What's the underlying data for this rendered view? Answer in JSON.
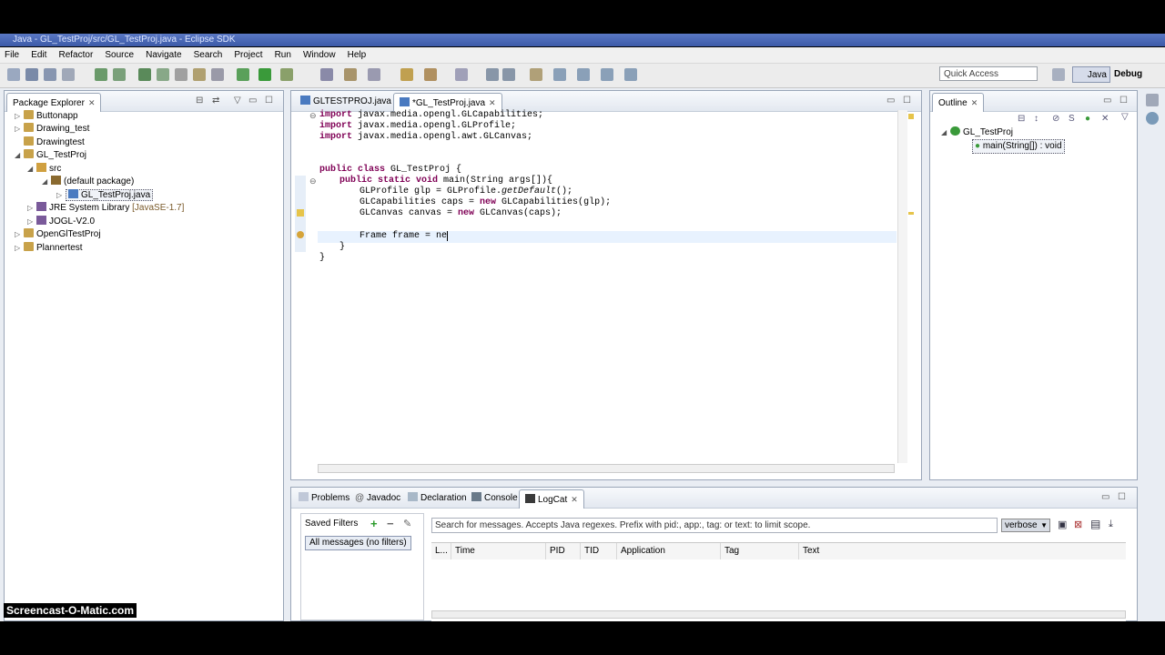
{
  "window": {
    "title": "Java - GL_TestProj/src/GL_TestProj.java - Eclipse SDK"
  },
  "menu": [
    "File",
    "Edit",
    "Refactor",
    "Source",
    "Navigate",
    "Search",
    "Project",
    "Run",
    "Window",
    "Help"
  ],
  "quick_access": {
    "placeholder": "Quick Access"
  },
  "perspectives": {
    "java": "Java",
    "debug": "Debug"
  },
  "package_explorer": {
    "tab": "Package Explorer",
    "items": [
      {
        "label": "Buttonapp"
      },
      {
        "label": "Drawing_test"
      },
      {
        "label": "Drawingtest"
      },
      {
        "label": "GL_TestProj"
      },
      {
        "label": "src"
      },
      {
        "label": "(default package)"
      },
      {
        "label": "GL_TestProj.java"
      },
      {
        "label": "JRE System Library",
        "suffix": "[JavaSE-1.7]"
      },
      {
        "label": "JOGL-V2.0"
      },
      {
        "label": "OpenGlTestProj"
      },
      {
        "label": "Plannertest"
      }
    ]
  },
  "editor": {
    "tabs": [
      {
        "label": "GLTESTPROJ.java"
      },
      {
        "label": "*GL_TestProj.java"
      }
    ],
    "lines": {
      "l1": {
        "kw": "import",
        "rest": " javax.media.opengl.GLCapabilities;"
      },
      "l2": {
        "kw": "import",
        "rest": " javax.media.opengl.GLProfile;"
      },
      "l3": {
        "kw": "import",
        "rest": " javax.media.opengl.awt.GLCanvas;"
      },
      "l4": {
        "kw": "public class",
        "rest": " GL_TestProj {"
      },
      "l5": {
        "kw": "public static void",
        "rest": " main(String args[]){"
      },
      "l6": {
        "a": "GLProfile glp = GLProfile.",
        "it": "getDefault",
        "b": "();"
      },
      "l7": {
        "a": "GLCapabilities caps = ",
        "kw": "new",
        "b": " GLCapabilities(glp);"
      },
      "l8": {
        "a": "GLCanvas canvas = ",
        "kw": "new",
        "b": " GLCanvas(caps);"
      },
      "l9": {
        "a": "Frame frame = ne"
      },
      "l10": {
        "a": "}"
      },
      "l11": {
        "a": "}"
      }
    }
  },
  "outline": {
    "tab": "Outline",
    "class": "GL_TestProj",
    "method": "main(String[]) : void"
  },
  "bottom": {
    "tabs": [
      "Problems",
      "Javadoc",
      "Declaration",
      "Console",
      "LogCat"
    ],
    "saved_filters": "Saved Filters",
    "all_messages": "All messages (no filters)",
    "search_placeholder": "Search for messages. Accepts Java regexes. Prefix with pid:, app:, tag: or text: to limit scope.",
    "level": "verbose",
    "columns": [
      "L...",
      "Time",
      "PID",
      "TID",
      "Application",
      "Tag",
      "Text"
    ]
  },
  "watermark": "Screencast-O-Matic.com"
}
